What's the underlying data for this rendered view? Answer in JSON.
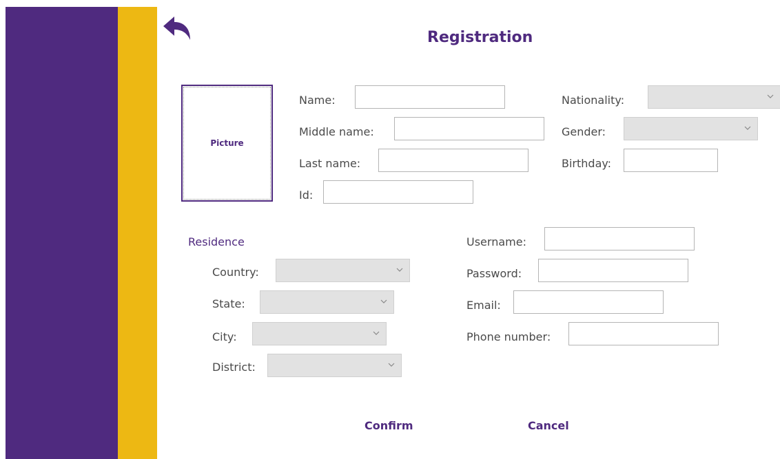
{
  "header": {
    "title": "Registration"
  },
  "picture": {
    "label": "Picture"
  },
  "personal": {
    "name_label": "Name:",
    "middle_name_label": "Middle name:",
    "last_name_label": "Last name:",
    "id_label": "Id:",
    "nationality_label": "Nationality:",
    "gender_label": "Gender:",
    "birthday_label": "Birthday:"
  },
  "residence": {
    "heading": "Residence",
    "country_label": "Country:",
    "state_label": "State:",
    "city_label": "City:",
    "district_label": "District:"
  },
  "account": {
    "username_label": "Username:",
    "password_label": "Password:",
    "email_label": "Email:",
    "phone_label": "Phone number:"
  },
  "actions": {
    "confirm": "Confirm",
    "cancel": "Cancel"
  },
  "colors": {
    "primary": "#4f2a7f",
    "accent": "#edb813"
  },
  "icons": {
    "back": "back-arrow-icon",
    "dropdown": "chevron-down-icon"
  }
}
